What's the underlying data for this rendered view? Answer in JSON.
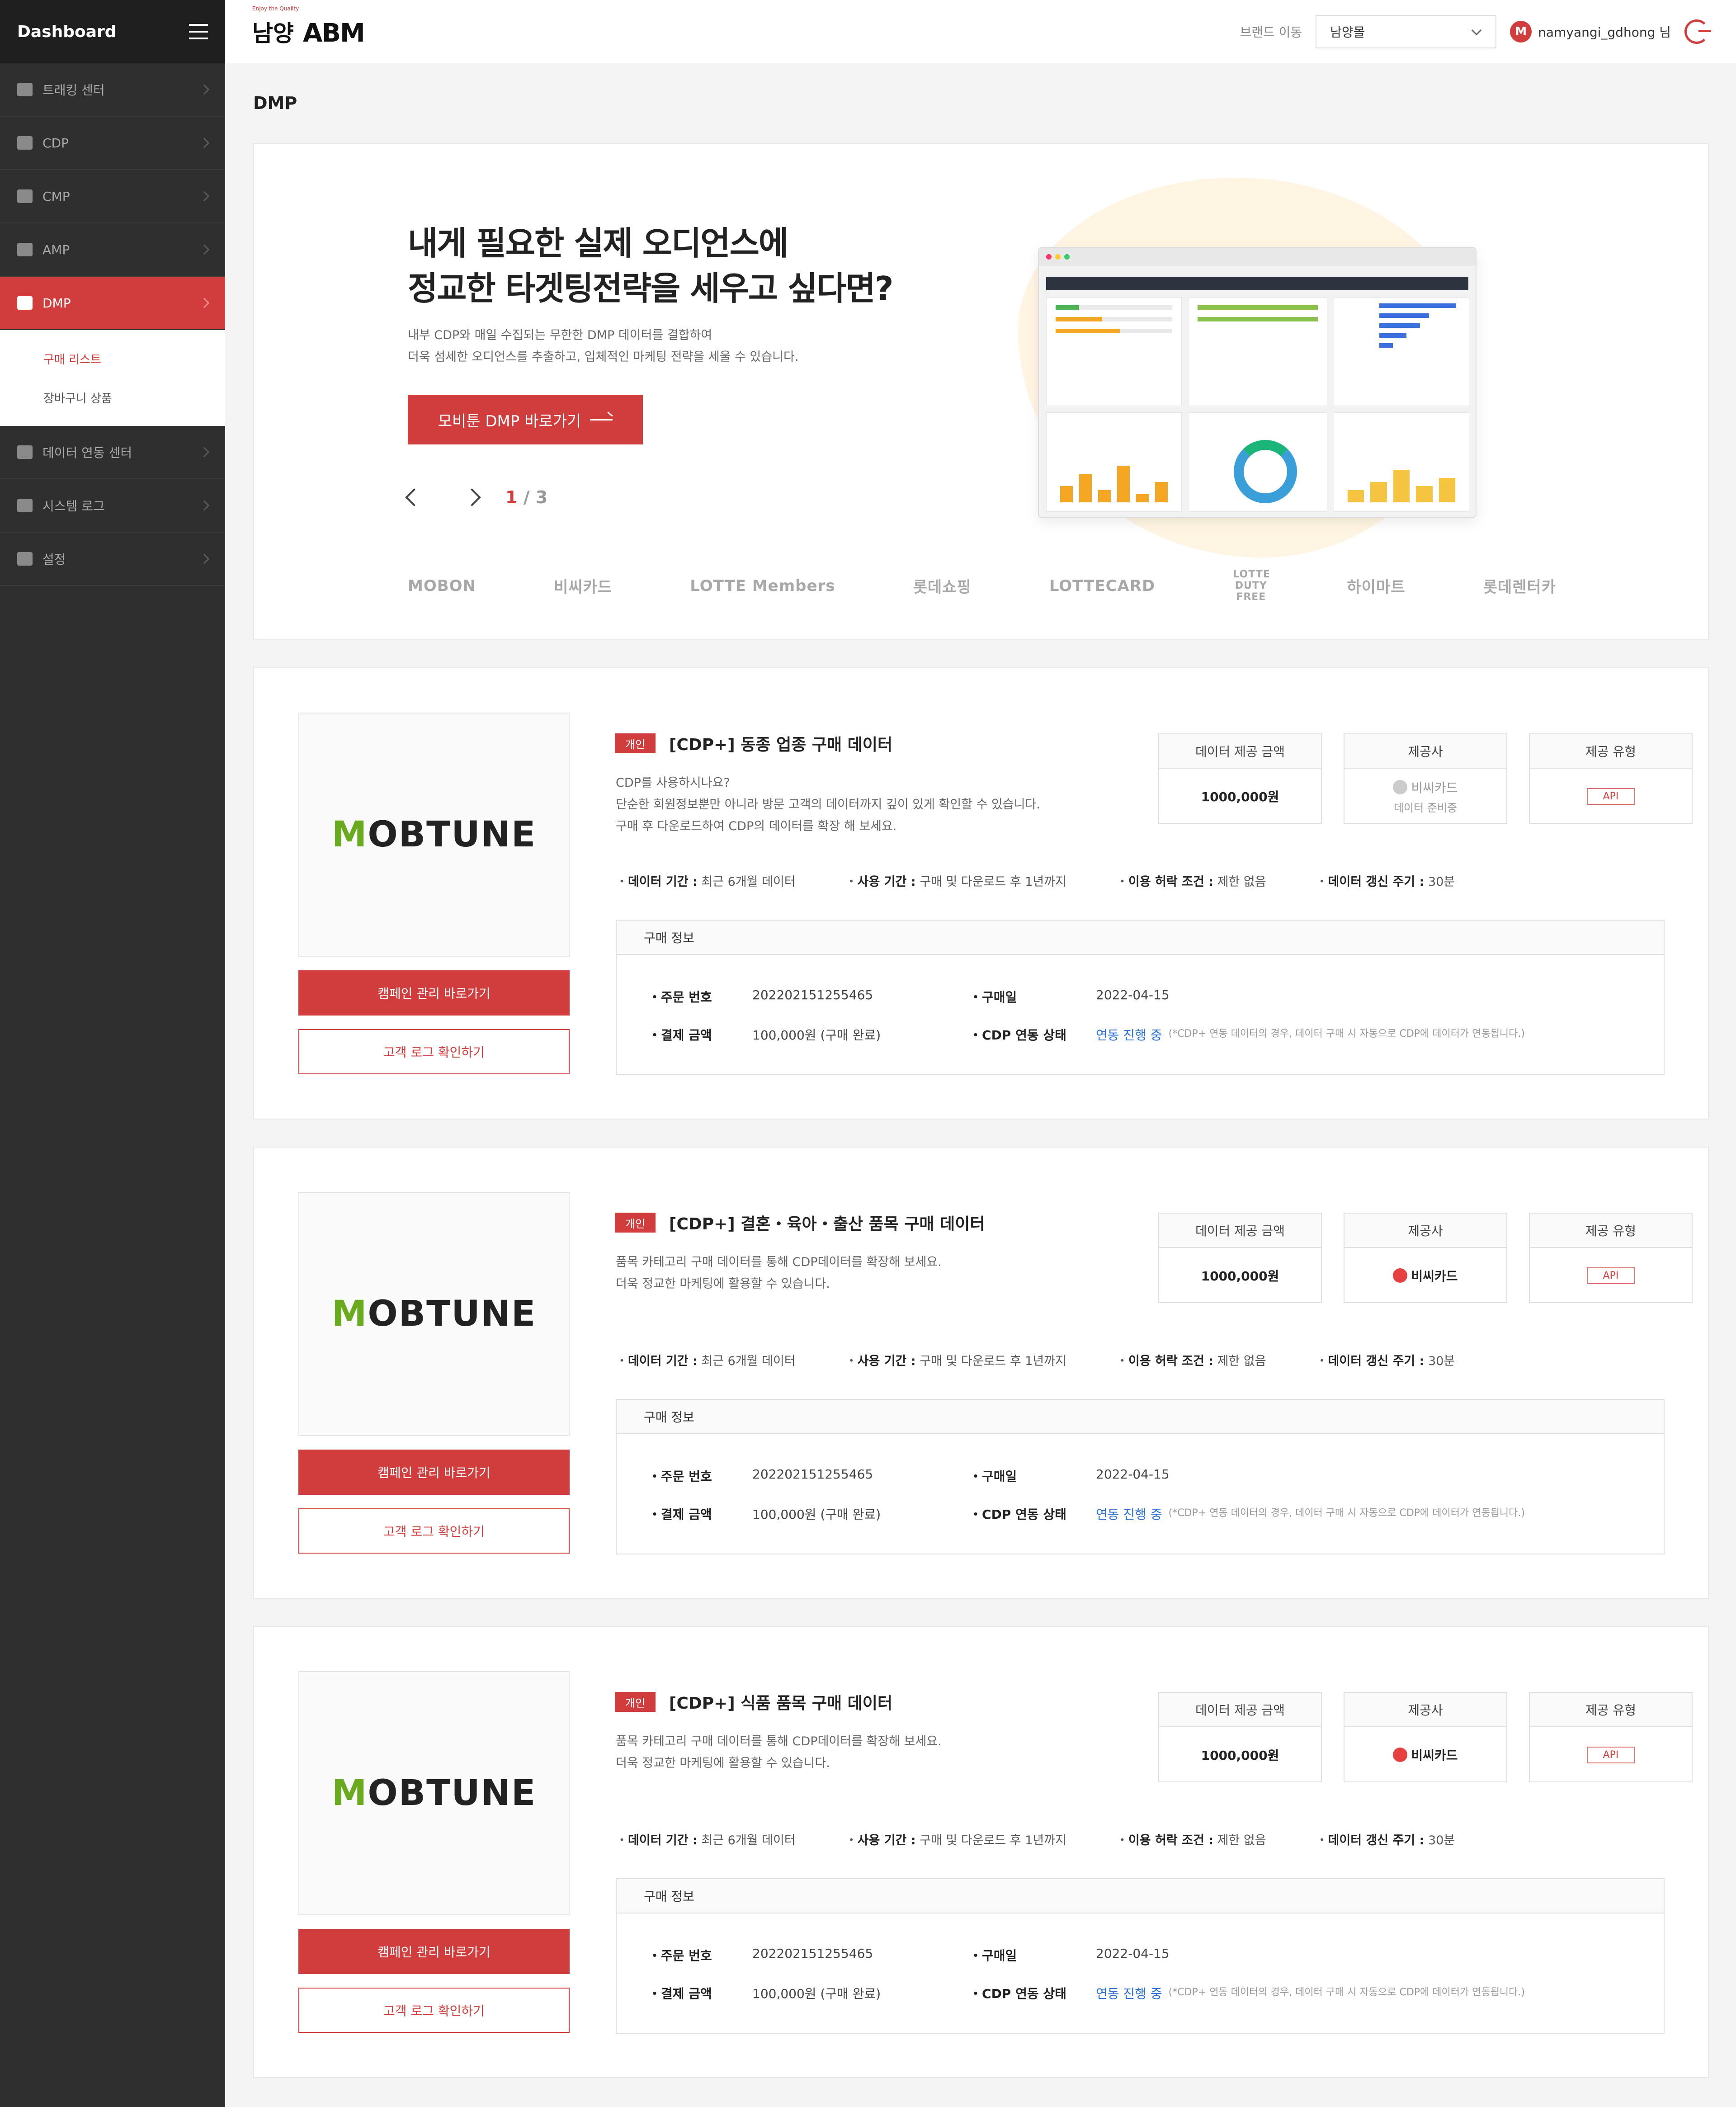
{
  "sidebar": {
    "title": "Dashboard",
    "items": [
      {
        "label": "트래킹 센터",
        "icon": "tracking-icon"
      },
      {
        "label": "CDP",
        "icon": "pie-chart-icon"
      },
      {
        "label": "CMP",
        "icon": "bar-chart-icon"
      },
      {
        "label": "AMP",
        "icon": "line-chart-icon"
      },
      {
        "label": "DMP",
        "icon": "document-icon"
      },
      {
        "label": "데이터 연동 센터",
        "icon": "share-icon"
      },
      {
        "label": "시스템 로그",
        "icon": "monitor-icon"
      },
      {
        "label": "설정",
        "icon": "gear-icon"
      }
    ],
    "sub": [
      "구매 리스트",
      "장바구니 상품"
    ]
  },
  "header": {
    "logo_sub": "Enjoy the Quality",
    "logo_main": "남양",
    "logo_abm": "ABM",
    "brand_label": "브랜드 이동",
    "brand_value": "남양몰",
    "user_initial": "M",
    "user_name": "namyangi_gdhong 님"
  },
  "page": {
    "title": "DMP"
  },
  "hero": {
    "headline1": "내게 필요한 실제 오디언스에",
    "headline2": "정교한 타겟팅전략을 세우고 싶다면?",
    "desc1": "내부 CDP와 매일 수집되는 무한한 DMP 데이터를 결합하여",
    "desc2": "더욱 섬세한 오디언스를 추출하고, 입체적인 마케팅 전략을 세울 수 있습니다.",
    "cta": "모비툰 DMP 바로가기",
    "page_current": "1",
    "page_sep": "/",
    "page_total": "3",
    "partners": [
      "MOBON",
      "비씨카드",
      "LOTTE Members",
      "롯데쇼핑",
      "LOTTECARD",
      "LOTTE DUTY FREE",
      "하이마트",
      "롯데렌터카"
    ]
  },
  "cards": [
    {
      "logo_m": "M",
      "logo_rest": "OBTUNE",
      "tag": "개인",
      "title": "[CDP+] 동종 업종 구매 데이터",
      "desc": [
        "CDP를 사용하시나요?",
        "단순한 회원정보뿐만 아니라 방문 고객의 데이터까지 깊이 있게 확인할 수 있습니다.",
        "구매 후 다운로드하여 CDP의 데이터를 확장 해 보세요."
      ],
      "price_label": "데이터 제공 금액",
      "price": "1000,000원",
      "provider_label": "제공사",
      "provider": "비씨카드",
      "provider_note": "데이터 준비중",
      "type_label": "제공 유형",
      "type": "API",
      "meta": [
        {
          "k": "데이터 기간 :",
          "v": "최근 6개월 데이터"
        },
        {
          "k": "사용 기간 :",
          "v": "구매 및 다운로드 후 1년까지"
        },
        {
          "k": "이용 허락 조건 :",
          "v": "제한 없음"
        },
        {
          "k": "데이터 갱신 주기 :",
          "v": "30분"
        }
      ],
      "info_title": "구매 정보",
      "order_k": "주문 번호",
      "order_v": "202202151255465",
      "date_k": "구매일",
      "date_v": "2022-04-15",
      "pay_k": "결제 금액",
      "pay_v": "100,000원 (구매 완료)",
      "cdp_k": "CDP 연동 상태",
      "cdp_v": "연동 진행 중",
      "cdp_note": "(*CDP+ 연동 데이터의 경우, 데이터 구매 시 자동으로 CDP에 데이터가 연동됩니다.)",
      "btn1": "캠페인 관리 바로가기",
      "btn2": "고객 로그 확인하기"
    },
    {
      "logo_m": "M",
      "logo_rest": "OBTUNE",
      "tag": "개인",
      "title": "[CDP+] 결혼・육아・출산 품목 구매 데이터",
      "desc": [
        "품목 카테고리 구매 데이터를 통해 CDP데이터를 확장해 보세요.",
        "더욱 정교한 마케팅에 활용할 수 있습니다."
      ],
      "price_label": "데이터 제공 금액",
      "price": "1000,000원",
      "provider_label": "제공사",
      "provider": "비씨카드",
      "provider_note": "",
      "type_label": "제공 유형",
      "type": "API",
      "meta": [
        {
          "k": "데이터 기간 :",
          "v": "최근 6개월 데이터"
        },
        {
          "k": "사용 기간 :",
          "v": "구매 및 다운로드 후 1년까지"
        },
        {
          "k": "이용 허락 조건 :",
          "v": "제한 없음"
        },
        {
          "k": "데이터 갱신 주기 :",
          "v": "30분"
        }
      ],
      "info_title": "구매 정보",
      "order_k": "주문 번호",
      "order_v": "202202151255465",
      "date_k": "구매일",
      "date_v": "2022-04-15",
      "pay_k": "결제 금액",
      "pay_v": "100,000원 (구매 완료)",
      "cdp_k": "CDP 연동 상태",
      "cdp_v": "연동 진행 중",
      "cdp_note": "(*CDP+ 연동 데이터의 경우, 데이터 구매 시 자동으로 CDP에 데이터가 연동됩니다.)",
      "btn1": "캠페인 관리 바로가기",
      "btn2": "고객 로그 확인하기"
    },
    {
      "logo_m": "M",
      "logo_rest": "OBTUNE",
      "tag": "개인",
      "title": "[CDP+] 식품 품목 구매 데이터",
      "desc": [
        "품목 카테고리 구매 데이터를 통해 CDP데이터를 확장해 보세요.",
        "더욱 정교한 마케팅에 활용할 수 있습니다."
      ],
      "price_label": "데이터 제공 금액",
      "price": "1000,000원",
      "provider_label": "제공사",
      "provider": "비씨카드",
      "provider_note": "",
      "type_label": "제공 유형",
      "type": "API",
      "meta": [
        {
          "k": "데이터 기간 :",
          "v": "최근 6개월 데이터"
        },
        {
          "k": "사용 기간 :",
          "v": "구매 및 다운로드 후 1년까지"
        },
        {
          "k": "이용 허락 조건 :",
          "v": "제한 없음"
        },
        {
          "k": "데이터 갱신 주기 :",
          "v": "30분"
        }
      ],
      "info_title": "구매 정보",
      "order_k": "주문 번호",
      "order_v": "202202151255465",
      "date_k": "구매일",
      "date_v": "2022-04-15",
      "pay_k": "결제 금액",
      "pay_v": "100,000원 (구매 완료)",
      "cdp_k": "CDP 연동 상태",
      "cdp_v": "연동 진행 중",
      "cdp_note": "(*CDP+ 연동 데이터의 경우, 데이터 구매 시 자동으로 CDP에 데이터가 연동됩니다.)",
      "btn1": "캠페인 관리 바로가기",
      "btn2": "고객 로그 확인하기"
    }
  ],
  "colors": {
    "accent": "#d13c3c",
    "sidebar": "#2f2f2f",
    "link": "#2a6fd6",
    "logo_green": "#6aaa1f"
  }
}
